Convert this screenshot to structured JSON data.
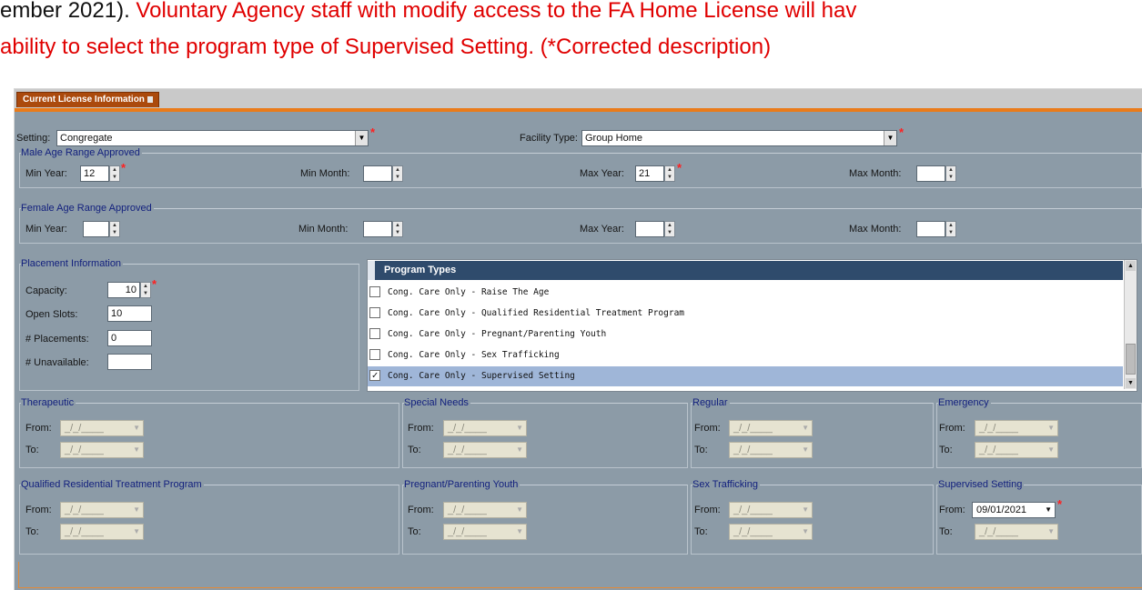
{
  "doc": {
    "line1_black": "ember 2021). ",
    "line1_red": "Voluntary Agency staff with modify access to the FA Home License will hav",
    "line2_red": "ability to select the program type of Supervised Setting. (*Corrected description)"
  },
  "window": {
    "tab_label": "Current License Information",
    "setting": {
      "label": "Setting:",
      "value": "Congregate"
    },
    "facility_type": {
      "label": "Facility Type:",
      "value": "Group Home"
    },
    "male_age": {
      "title": "Male Age Range Approved",
      "min_year_label": "Min Year:",
      "min_year": "12",
      "min_month_label": "Min Month:",
      "min_month": "",
      "max_year_label": "Max Year:",
      "max_year": "21",
      "max_month_label": "Max Month:",
      "max_month": ""
    },
    "female_age": {
      "title": "Female Age Range Approved",
      "min_year_label": "Min Year:",
      "min_year": "",
      "min_month_label": "Min Month:",
      "min_month": "",
      "max_year_label": "Max Year:",
      "max_year": "",
      "max_month_label": "Max Month:",
      "max_month": ""
    },
    "placement": {
      "title": "Placement Information",
      "capacity_label": "Capacity:",
      "capacity": "10",
      "open_slots_label": "Open Slots:",
      "open_slots": "10",
      "placements_label": "# Placements:",
      "placements": "0",
      "unavailable_label": "# Unavailable:",
      "unavailable": ""
    },
    "program_types": {
      "header": "Program Types",
      "items": [
        {
          "label": "Cong. Care Only - Raise The Age",
          "checked": false,
          "mark": ""
        },
        {
          "label": "Cong. Care Only - Qualified Residential Treatment Program",
          "checked": false,
          "mark": ""
        },
        {
          "label": "Cong. Care Only - Pregnant/Parenting Youth",
          "checked": false,
          "mark": ""
        },
        {
          "label": "Cong. Care Only - Sex Trafficking",
          "checked": false,
          "mark": ""
        },
        {
          "label": "Cong. Care Only - Supervised Setting",
          "checked": true,
          "mark": "✓"
        }
      ]
    },
    "date_groups": {
      "from_label": "From:",
      "to_label": "To:",
      "empty_date": "_/_/____",
      "therapeutic": "Therapeutic",
      "special_needs": "Special Needs",
      "regular": "Regular",
      "emergency": "Emergency",
      "qrtp": "Qualified Residential Treatment Program",
      "pregnant": "Pregnant/Parenting Youth",
      "sex_trafficking": "Sex Trafficking",
      "supervised": "Supervised Setting",
      "supervised_from": "09/01/2021"
    }
  }
}
